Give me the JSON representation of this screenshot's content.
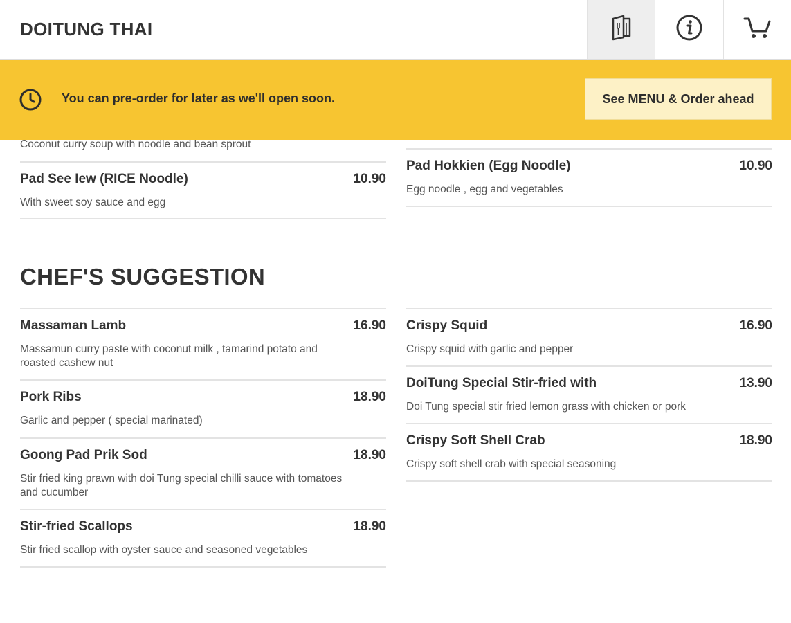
{
  "header": {
    "title": "DOITUNG THAI",
    "icons": [
      "menu-book-icon",
      "info-icon",
      "cart-icon"
    ]
  },
  "banner": {
    "message": "You can pre-order for later as we'll open soon.",
    "button_label": "See MENU & Order ahead",
    "color": "#f7c531"
  },
  "noodles_partial": {
    "left_cut_desc": "Coconut curry soup with noodle and bean sprout",
    "left_items": [
      {
        "name": "Pad See Iew (RICE Noodle)",
        "price": "10.90",
        "desc": "With sweet soy sauce and egg"
      }
    ],
    "right_items": [
      {
        "name": "Pad Hokkien (Egg Noodle)",
        "price": "10.90",
        "desc": "Egg noodle , egg and vegetables"
      }
    ]
  },
  "chefs_suggestion": {
    "title": "CHEF'S SUGGESTION",
    "left_items": [
      {
        "name": "Massaman Lamb",
        "price": "16.90",
        "desc": "Massamun curry paste with coconut milk , tamarind potato and roasted cashew nut"
      },
      {
        "name": "Pork Ribs",
        "price": "18.90",
        "desc": "Garlic and pepper ( special marinated)"
      },
      {
        "name": "Goong Pad Prik Sod",
        "price": "18.90",
        "desc": "Stir fried king prawn with doi Tung special chilli sauce with tomatoes and cucumber"
      },
      {
        "name": "Stir-fried Scallops",
        "price": "18.90",
        "desc": "Stir fried scallop with oyster sauce and seasoned vegetables"
      }
    ],
    "right_items": [
      {
        "name": "Crispy Squid",
        "price": "16.90",
        "desc": "Crispy squid with garlic and pepper"
      },
      {
        "name": "DoiTung Special Stir-fried with",
        "price": "13.90",
        "desc": "Doi Tung special stir fried lemon grass with chicken or pork"
      },
      {
        "name": "Crispy Soft Shell Crab",
        "price": "18.90",
        "desc": "Crispy soft shell crab with special seasoning"
      }
    ]
  }
}
